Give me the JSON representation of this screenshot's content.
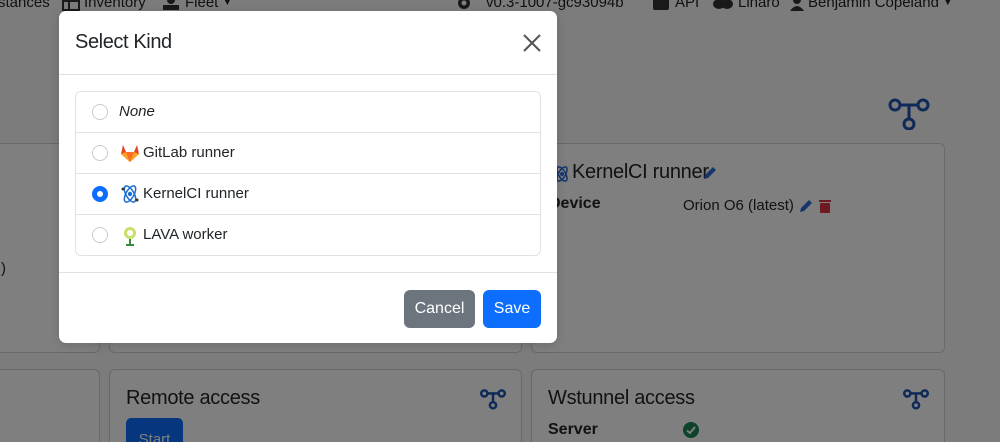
{
  "nav": {
    "items": [
      {
        "label": "stances"
      },
      {
        "label": "Inventory",
        "icon": "table-icon"
      },
      {
        "label": "Fleet",
        "icon": "fleet-icon"
      },
      {
        "label": "v0.3-1007-gc93094b",
        "icon": "gear-icon"
      },
      {
        "label": "API",
        "icon": "robot-icon"
      },
      {
        "label": "Linaro",
        "icon": "handshake-icon"
      },
      {
        "label": "Benjamin Copeland",
        "icon": "user-icon"
      }
    ]
  },
  "background": {
    "kernelci_card": {
      "title": "KernelCI runner",
      "device_label": "Device",
      "device_value": "Orion O6 (latest)"
    },
    "left_card": {
      "fragment": ")"
    },
    "remote_access": {
      "title": "Remote access",
      "start_label": "Start"
    },
    "wstunnel": {
      "title": "Wstunnel access",
      "server_label": "Server"
    }
  },
  "modal": {
    "title": "Select Kind",
    "options": [
      {
        "label": "None",
        "icon": "",
        "checked": false
      },
      {
        "label": "GitLab runner",
        "icon": "gitlab-icon",
        "checked": false
      },
      {
        "label": "KernelCI runner",
        "icon": "kernelci-icon",
        "checked": true
      },
      {
        "label": "LAVA worker",
        "icon": "lava-icon",
        "checked": false
      }
    ],
    "cancel_label": "Cancel",
    "save_label": "Save"
  },
  "colors": {
    "primary": "#0d6efd",
    "secondary": "#6c757d",
    "danger": "#dc3545",
    "success": "#198754",
    "network_icon": "#1e52b0"
  }
}
